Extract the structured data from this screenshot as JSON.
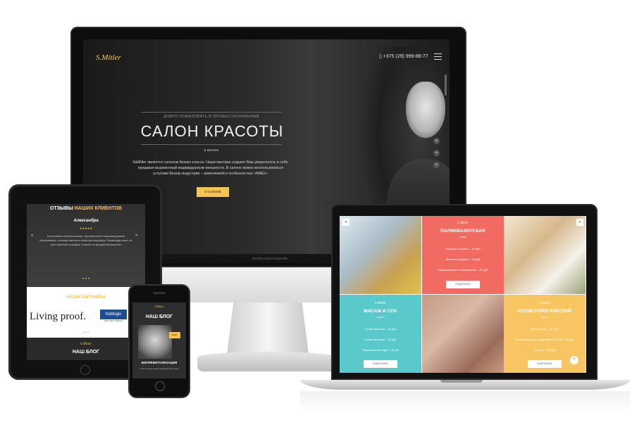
{
  "desktop": {
    "logo": "S.Mitler",
    "phone": "▯ +375 (29) 999-88-77",
    "welcome": "ДОБРО ПОЖАЛОВАТЬ В ПРОФЕССИОНАЛЬНЫЙ",
    "title": "САЛОН КРАСОТЫ",
    "city": "в минске",
    "intro": "S&Mitler является салоном бизнес-класса. Наши мастера создают Вам уверенность в себе, придавая выраженный индивидуализм внешности. В салоне можно воспользоваться услугами Beauty-индустрии – изменяемой и особенностью «MitlEr».",
    "cta": "О САЛОНЕ",
    "strip_text": "ЗАПИСАТЬСЯ ОНЛАЙН"
  },
  "tablet": {
    "heading_a": "ОТЗЫВЫ",
    "heading_b": "НАШИХ КЛИЕНТОВ",
    "reviewer": "Александра",
    "stars": "★★★★★",
    "review": "Я постоянная клиентка салона. Хороший салон с высоким уровнем обслуживания, отличные мастера и приятная атмосфера. Рекомендую всем, кто ценит качество и комфорт. Спасибо за прекрасный результат!",
    "partners": "НАШИ ПАРТНЕРЫ",
    "partner_1": "Living proof.",
    "partner_2": "footlogix",
    "partner_2_sub": "PEDI-MED SERIES",
    "blog_logo": "S.Mitler",
    "blog": "НАШ БЛОГ",
    "dots": "• • •"
  },
  "phone": {
    "logo": "S.Mitler",
    "blog": "НАШ БЛОГ",
    "tag": "БЛОГ",
    "post_title": "БИОРЕВИТАЛИЗАЦИЯ",
    "post_text": "Очень интересная процедура для лица"
  },
  "laptop": {
    "logo": "S.Mitler",
    "hair": {
      "title": "ПАРИКМАХЕРСКАЯ",
      "sub": "салон",
      "items": [
        "Мужская стрижка – 10 руб",
        "Женская стрижка – 15 руб",
        "Окрашивание и тонирование – 20 руб"
      ],
      "button": "ПОДРОБНЕЕ"
    },
    "spa": {
      "title": "МАСАЖ И СПА",
      "sub": "салон",
      "items": [
        "Спина мужская – 10 руб",
        "Спина женская – 15 руб",
        "Пожизненный отдел – 8 руб"
      ],
      "button": "ПОДРОБНЕЕ"
    },
    "cosm": {
      "title": "КОСМЕТОЛОГИЧЕСКИЙ",
      "sub": "салон",
      "items": [
        "Чистка лица – 40 руб",
        "Антивозрастная программа COCOA – 55 руб",
        "Пилинг – 25 руб"
      ],
      "button": "ПОДРОБНЕЕ"
    },
    "prev": "«",
    "next": "»",
    "up": "^"
  },
  "colors": {
    "accent": "#f5c253",
    "pink": "#f26b63",
    "teal": "#59c9cc",
    "yellow": "#f7c660"
  }
}
